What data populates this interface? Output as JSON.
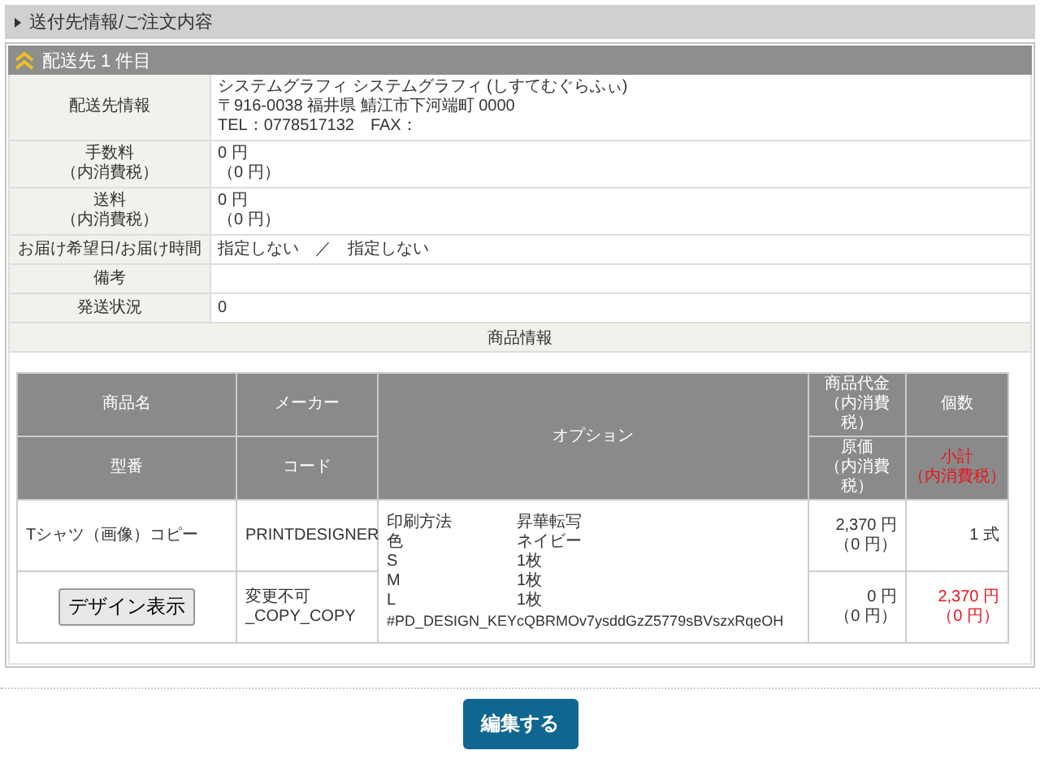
{
  "section_title": "送付先情報/ご注文内容",
  "shipment": {
    "title": "配送先 1 件目",
    "info_rows": [
      {
        "label": [
          "配送先情報"
        ],
        "lines": [
          "システムグラフィ システムグラフィ (しすてむぐらふぃ)",
          "〒916-0038 福井県 鯖江市下河端町 0000",
          "TEL：0778517132　FAX："
        ]
      },
      {
        "label": [
          "手数料",
          "（内消費税）"
        ],
        "lines": [
          "0 円",
          "（0 円）"
        ]
      },
      {
        "label": [
          "送料",
          "（内消費税）"
        ],
        "lines": [
          "0 円",
          "（0 円）"
        ]
      },
      {
        "label": [
          "お届け希望日/お届け時間"
        ],
        "lines": [
          "指定しない　／　指定しない"
        ]
      },
      {
        "label": [
          "備考"
        ],
        "lines": []
      },
      {
        "label": [
          "発送状況"
        ],
        "lines": [
          "0"
        ]
      }
    ],
    "products_heading": "商品情報",
    "product_header": {
      "name": "商品名",
      "maker": "メーカー",
      "option": "オプション",
      "price": [
        "商品代金",
        "（内消費",
        "税）"
      ],
      "quantity": "個数",
      "model": "型番",
      "code": "コード",
      "cost": [
        "原価",
        "（内消費",
        "税）"
      ],
      "subtotal": [
        "小計",
        "（内消費税）"
      ]
    },
    "products": [
      {
        "name": "Tシャツ（画像）コピー",
        "maker": "PRINTDESIGNER",
        "design_button": "デザイン表示",
        "code": [
          "変更不可",
          "_COPY_COPY"
        ],
        "options": [
          {
            "name": "印刷方法",
            "value": "昇華転写"
          },
          {
            "name": "色",
            "value": "ネイビー"
          },
          {
            "name": "S",
            "value": "1枚"
          },
          {
            "name": "M",
            "value": "1枚"
          },
          {
            "name": "L",
            "value": "1枚"
          }
        ],
        "design_key": "#PD_DESIGN_KEYcQBRMOv7ysddGzZ5779sBVszxRqeOH",
        "price": [
          "2,370 円",
          "（0 円）"
        ],
        "quantity": "1 式",
        "cost": [
          "0 円",
          "（0 円）"
        ],
        "subtotal": [
          "2,370 円",
          "（0 円）"
        ]
      }
    ]
  },
  "edit_button": "編集する"
}
